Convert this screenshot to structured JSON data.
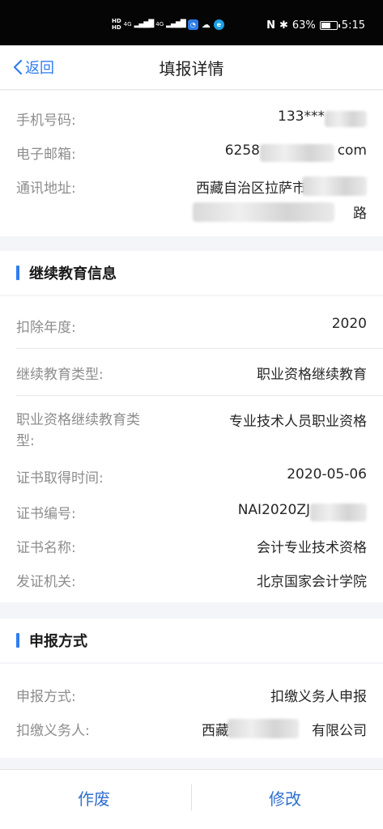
{
  "status_bar": {
    "hd1": "HD",
    "hd2": "HD",
    "network": "4G",
    "battery_percent": "63%",
    "battery_level": 0.63,
    "time": "5:15"
  },
  "nav": {
    "back_label": "返回",
    "title": "填报详情"
  },
  "contact": {
    "phone_label": "手机号码:",
    "phone_value": "133***",
    "email_label": "电子邮箱:",
    "email_prefix": "6258",
    "email_suffix": "com",
    "address_label": "通讯地址:",
    "address_value": "西藏自治区拉萨市",
    "address_tail": "路"
  },
  "education": {
    "section_title": "继续教育信息",
    "year_label": "扣除年度:",
    "year_value": "2020",
    "type_label": "继续教育类型:",
    "type_value": "职业资格继续教育",
    "subtype_label_line1": "职业资格继续教育类",
    "subtype_label_line2": "型:",
    "subtype_value": "专业技术人员职业资格",
    "cert_date_label": "证书取得时间:",
    "cert_date_value": "2020-05-06",
    "cert_no_label": "证书编号:",
    "cert_no_value": "NAI2020ZJ",
    "cert_name_label": "证书名称:",
    "cert_name_value": "会计专业技术资格",
    "issuer_label": "发证机关:",
    "issuer_value": "北京国家会计学院"
  },
  "filing": {
    "section_title": "申报方式",
    "method_label": "申报方式:",
    "method_value": "扣缴义务人申报",
    "agent_label": "扣缴义务人:",
    "agent_prefix": "西藏",
    "agent_suffix": "有限公司"
  },
  "actions": {
    "void_label": "作废",
    "edit_label": "修改"
  },
  "colors": {
    "accent": "#2f7df0",
    "label": "#8d8d8d",
    "value": "#262626"
  }
}
